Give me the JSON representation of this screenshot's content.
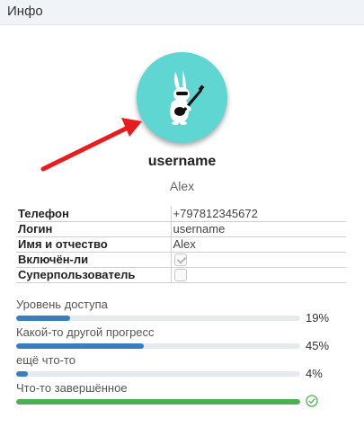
{
  "header": {
    "title": "Инфо"
  },
  "profile": {
    "username": "username",
    "full_name": "Alex",
    "avatar_icon": "rabbit-guitar-icon"
  },
  "info_table": [
    {
      "key": "Телефон",
      "value": "+797812345672"
    },
    {
      "key": "Логин",
      "value": "username"
    },
    {
      "key": "Имя и отчество",
      "value": "Alex"
    },
    {
      "key": "Включён-ли",
      "checked": true
    },
    {
      "key": "Суперпользователь",
      "checked": false
    }
  ],
  "progress": [
    {
      "label": "Уровень доступа",
      "value_text": "19%",
      "fraction": 0.19,
      "color": "#3a7ebf"
    },
    {
      "label": "Какой-то другой прогресс",
      "value_text": "45%",
      "fraction": 0.45,
      "color": "#3a7ebf"
    },
    {
      "label": "ещё что-то",
      "value_text": "4%",
      "fraction": 0.04,
      "color": "#3a7ebf"
    },
    {
      "label": "Что-то завершённое",
      "fraction": 1.0,
      "color": "#4caf50",
      "status_icon": "check-circle-icon"
    }
  ],
  "colors": {
    "avatar_bg": "#5fd6d2",
    "arrow": "#e81c1c",
    "success": "#4caf50"
  }
}
